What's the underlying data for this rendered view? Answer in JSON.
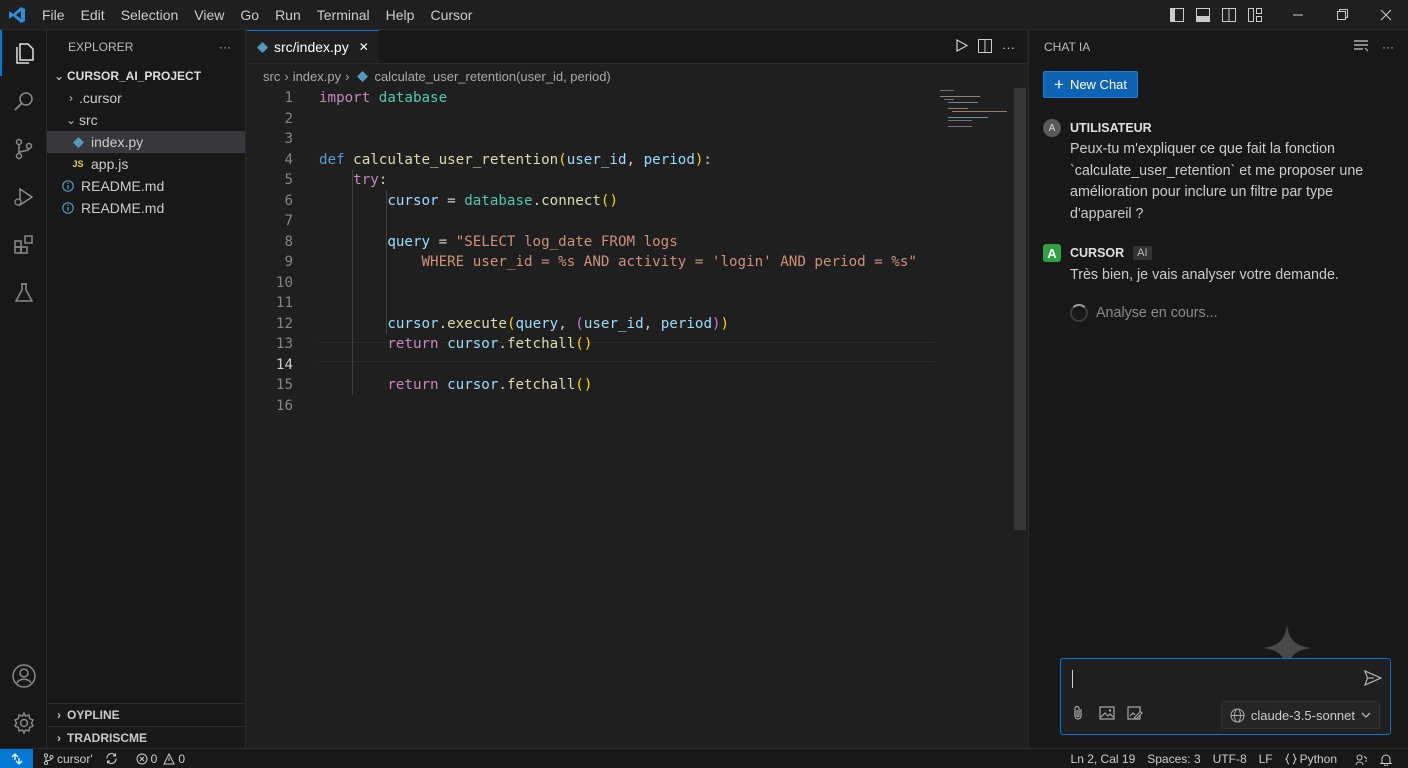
{
  "menu": [
    "File",
    "Edit",
    "Selection",
    "View",
    "Go",
    "Run",
    "Terminal",
    "Help",
    "Cursor"
  ],
  "explorer": {
    "title": "EXPLORER",
    "more": "···",
    "project": "CURSOR_AI_PROJECT",
    "items": [
      {
        "label": ".cursor",
        "chevron": "›"
      },
      {
        "label": "src",
        "chevron": "⌄"
      },
      {
        "label": "index.py"
      },
      {
        "label": "app.js",
        "icon": "JS"
      },
      {
        "label": "README.md"
      },
      {
        "label": "README.md"
      }
    ],
    "outline": "OYPLINE",
    "timeline": "TRADRISCME"
  },
  "editor": {
    "tab_label": "src/index.py",
    "tab_close": "✕",
    "breadcrumb": {
      "folder": "src",
      "file": "index.py",
      "symbol": "calculate_user_retention(user_id, period)"
    },
    "sep": "›",
    "more": "···",
    "line_numbers": [
      "1",
      "2",
      "3",
      "4",
      "5",
      "6",
      "7",
      "8",
      "9",
      "10",
      "11",
      "12",
      "13",
      "14",
      "15",
      "16"
    ],
    "code": {
      "l1_kw": "import",
      "l1_mod": "database",
      "l4_kw": "def",
      "l4_fn": "calculate_user_retention",
      "l4_p1": "user_id",
      "l4_p2": "period",
      "l5_kw": "try",
      "l6_var": "cursor",
      "l6_mod": "database",
      "l6_fn": "connect",
      "l8_var": "query",
      "l8_str": "\"SELECT log_date FROM logs",
      "l9_str": "WHERE user_id = %s AND activity = 'login' AND period = %s\"",
      "l12_var": "cursor",
      "l12_fn": "execute",
      "l12_a1": "query",
      "l12_a2": "user_id",
      "l12_a3": "period",
      "l13_kw": "return",
      "l13_var": "cursor",
      "l13_fn": "fetchall",
      "l15_kw": "return",
      "l15_var": "cursor",
      "l15_fn": "fetchall"
    }
  },
  "chat": {
    "title": "CHAT IA",
    "more": "···",
    "new_chat": "New Chat",
    "user_initial": "A",
    "user_label": "UTILISATEUR",
    "user_message": "Peux-tu m'expliquer ce que fait la fonction `calculate_user_retention` et me proposer une amélioration pour inclure un filtre par type d'appareil ?",
    "ai_initial": "A",
    "ai_label": "CURSOR",
    "ai_badge": "AI",
    "ai_message": "Très bien, je vais analyser votre demande.",
    "loading": "Analyse en cours...",
    "model": "claude-3.5-sonnet"
  },
  "status": {
    "branch": "cursor'",
    "problems_errors": "0",
    "problems_warnings": "0",
    "position": "Ln 2, Cal 19",
    "spaces": "Spaces: 3",
    "encoding": "UTF-8",
    "eol": "LF",
    "language": "Python"
  },
  "colors": {
    "accent": "#0078d4",
    "new_chat_bg": "#0e63b5",
    "ai_avatar": "#2ea043"
  }
}
